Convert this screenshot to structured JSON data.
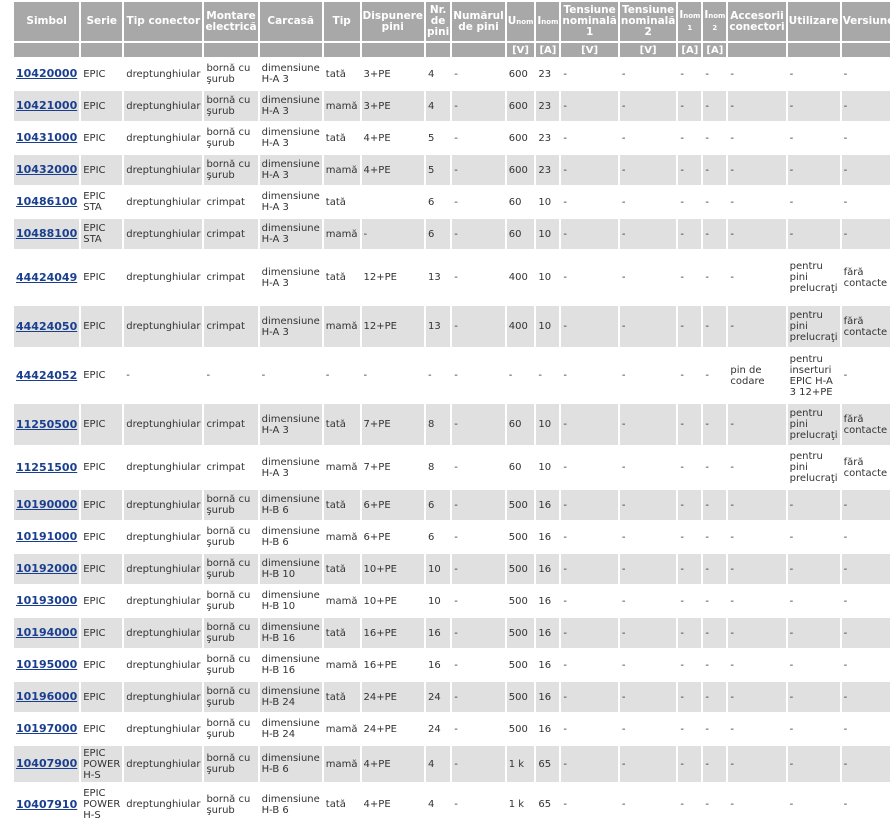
{
  "headers": [
    {
      "label": "Simbol",
      "unit": ""
    },
    {
      "label": "Serie",
      "unit": ""
    },
    {
      "label": "Tip conector",
      "unit": ""
    },
    {
      "label": "Montare electrică",
      "unit": ""
    },
    {
      "label": "Carcasă",
      "unit": ""
    },
    {
      "label": "Tip",
      "unit": ""
    },
    {
      "label": "Dispunere pini",
      "unit": ""
    },
    {
      "label": "Nr. de pini",
      "unit": ""
    },
    {
      "label": "Numărul de pini",
      "unit": ""
    },
    {
      "label": "U",
      "sub": "nom",
      "unit": "[V]"
    },
    {
      "label": "I",
      "sub": "nom",
      "unit": "[A]"
    },
    {
      "label": "Tensiune nominală 1",
      "unit": "[V]"
    },
    {
      "label": "Tensiune nominală 2",
      "unit": "[V]"
    },
    {
      "label": "I",
      "sub": "nom 1",
      "unit": "[A]"
    },
    {
      "label": "I",
      "sub": "nom 2",
      "unit": "[A]"
    },
    {
      "label": "Accesorii conectori",
      "unit": ""
    },
    {
      "label": "Utilizare",
      "unit": ""
    },
    {
      "label": "Versiune",
      "unit": ""
    }
  ],
  "rows": [
    [
      "10420000",
      "EPIC",
      "dreptunghiular",
      "bornă cu şurub",
      "dimensiune H-A 3",
      "tată",
      "3+PE",
      "4",
      "-",
      "600",
      "23",
      "-",
      "-",
      "-",
      "-",
      "-",
      "-",
      "-"
    ],
    [
      "10421000",
      "EPIC",
      "dreptunghiular",
      "bornă cu şurub",
      "dimensiune H-A 3",
      "mamă",
      "3+PE",
      "4",
      "-",
      "600",
      "23",
      "-",
      "-",
      "-",
      "-",
      "-",
      "-",
      "-"
    ],
    [
      "10431000",
      "EPIC",
      "dreptunghiular",
      "bornă cu şurub",
      "dimensiune H-A 3",
      "tată",
      "4+PE",
      "5",
      "-",
      "600",
      "23",
      "-",
      "-",
      "-",
      "-",
      "-",
      "-",
      "-"
    ],
    [
      "10432000",
      "EPIC",
      "dreptunghiular",
      "bornă cu şurub",
      "dimensiune H-A 3",
      "mamă",
      "4+PE",
      "5",
      "-",
      "600",
      "23",
      "-",
      "-",
      "-",
      "-",
      "-",
      "-",
      "-"
    ],
    [
      "10486100",
      "EPIC STA",
      "dreptunghiular",
      "crimpat",
      "dimensiune H-A 3",
      "tată",
      "",
      "6",
      "-",
      "60",
      "10",
      "-",
      "-",
      "-",
      "-",
      "-",
      "-",
      "-"
    ],
    [
      "10488100",
      "EPIC STA",
      "dreptunghiular",
      "crimpat",
      "dimensiune H-A 3",
      "mamă",
      "-",
      "6",
      "-",
      "60",
      "10",
      "-",
      "-",
      "-",
      "-",
      "-",
      "-",
      "-"
    ],
    [
      "44424049",
      "EPIC",
      "dreptunghiular",
      "crimpat",
      "dimensiune H-A 3",
      "tată",
      "12+PE",
      "13",
      "-",
      "400",
      "10",
      "-",
      "-",
      "-",
      "-",
      "-",
      "pentru pini prelucraţi",
      "fără contacte"
    ],
    [
      "44424050",
      "EPIC",
      "dreptunghiular",
      "crimpat",
      "dimensiune H-A 3",
      "mamă",
      "12+PE",
      "13",
      "-",
      "400",
      "10",
      "-",
      "-",
      "-",
      "-",
      "-",
      "pentru pini prelucraţi",
      "fără contacte"
    ],
    [
      "44424052",
      "EPIC",
      "-",
      "-",
      "-",
      "-",
      "-",
      "-",
      "-",
      "-",
      "-",
      "-",
      "-",
      "-",
      "-",
      "pin de codare",
      "pentru inserturi EPIC H-A 3 12+PE",
      "-"
    ],
    [
      "11250500",
      "EPIC",
      "dreptunghiular",
      "crimpat",
      "dimensiune H-A 3",
      "tată",
      "7+PE",
      "8",
      "-",
      "60",
      "10",
      "-",
      "-",
      "-",
      "-",
      "-",
      "pentru pini prelucraţi",
      "fără contacte"
    ],
    [
      "11251500",
      "EPIC",
      "dreptunghiular",
      "crimpat",
      "dimensiune H-A 3",
      "mamă",
      "7+PE",
      "8",
      "-",
      "60",
      "10",
      "-",
      "-",
      "-",
      "-",
      "-",
      "pentru pini prelucraţi",
      "fără contacte"
    ],
    [
      "10190000",
      "EPIC",
      "dreptunghiular",
      "bornă cu şurub",
      "dimensiune H-B 6",
      "tată",
      "6+PE",
      "6",
      "-",
      "500",
      "16",
      "-",
      "-",
      "-",
      "-",
      "-",
      "-",
      "-"
    ],
    [
      "10191000",
      "EPIC",
      "dreptunghiular",
      "bornă cu şurub",
      "dimensiune H-B 6",
      "mamă",
      "6+PE",
      "6",
      "-",
      "500",
      "16",
      "-",
      "-",
      "-",
      "-",
      "-",
      "-",
      "-"
    ],
    [
      "10192000",
      "EPIC",
      "dreptunghiular",
      "bornă cu şurub",
      "dimensiune H-B 10",
      "tată",
      "10+PE",
      "10",
      "-",
      "500",
      "16",
      "-",
      "-",
      "-",
      "-",
      "-",
      "-",
      "-"
    ],
    [
      "10193000",
      "EPIC",
      "dreptunghiular",
      "bornă cu şurub",
      "dimensiune H-B 10",
      "mamă",
      "10+PE",
      "10",
      "-",
      "500",
      "16",
      "-",
      "-",
      "-",
      "-",
      "-",
      "-",
      "-"
    ],
    [
      "10194000",
      "EPIC",
      "dreptunghiular",
      "bornă cu şurub",
      "dimensiune H-B 16",
      "tată",
      "16+PE",
      "16",
      "-",
      "500",
      "16",
      "-",
      "-",
      "-",
      "-",
      "-",
      "-",
      "-"
    ],
    [
      "10195000",
      "EPIC",
      "dreptunghiular",
      "bornă cu şurub",
      "dimensiune H-B 16",
      "mamă",
      "16+PE",
      "16",
      "-",
      "500",
      "16",
      "-",
      "-",
      "-",
      "-",
      "-",
      "-",
      "-"
    ],
    [
      "10196000",
      "EPIC",
      "dreptunghiular",
      "bornă cu şurub",
      "dimensiune H-B 24",
      "tată",
      "24+PE",
      "24",
      "-",
      "500",
      "16",
      "-",
      "-",
      "-",
      "-",
      "-",
      "-",
      "-"
    ],
    [
      "10197000",
      "EPIC",
      "dreptunghiular",
      "bornă cu şurub",
      "dimensiune H-B 24",
      "mamă",
      "24+PE",
      "24",
      "-",
      "500",
      "16",
      "-",
      "-",
      "-",
      "-",
      "-",
      "-",
      "-"
    ],
    [
      "10407900",
      "EPIC POWER H-S",
      "dreptunghiular",
      "bornă cu şurub",
      "dimensiune H-B 6",
      "mamă",
      "4+PE",
      "4",
      "-",
      "1 k",
      "65",
      "-",
      "-",
      "-",
      "-",
      "-",
      "-",
      "-"
    ],
    [
      "10407910",
      "EPIC POWER H-S",
      "dreptunghiular",
      "bornă cu şurub",
      "dimensiune H-B 6",
      "tată",
      "4+PE",
      "4",
      "-",
      "1 k",
      "65",
      "-",
      "-",
      "-",
      "-",
      "-",
      "-",
      "-"
    ]
  ]
}
